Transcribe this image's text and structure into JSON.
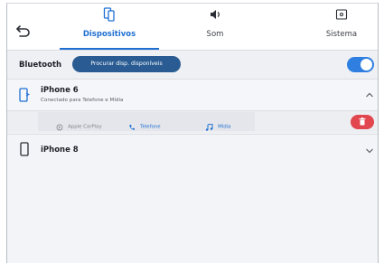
{
  "tabs": [
    {
      "label": "Dispositivos",
      "icon": "phone-link-icon",
      "active": true
    },
    {
      "label": "Som",
      "icon": "speaker-icon",
      "active": false
    },
    {
      "label": "Sistema",
      "icon": "system-screen-icon",
      "active": false
    }
  ],
  "bluetooth": {
    "label": "Bluetooth",
    "scan_button": "Procurar disp. disponíveis",
    "enabled": true
  },
  "devices": [
    {
      "name": "iPhone 6",
      "status": "Conectado para Telefone e Mídia",
      "expanded": true,
      "profiles": [
        {
          "label": "Apple CarPlay",
          "icon": "carplay-icon",
          "active": false
        },
        {
          "label": "Telefone",
          "icon": "phone-handset-icon",
          "active": true
        },
        {
          "label": "Mídia",
          "icon": "music-note-icon",
          "active": true
        }
      ]
    },
    {
      "name": "iPhone 8",
      "status": "",
      "expanded": false
    }
  ],
  "colors": {
    "accent": "#1f6fd2",
    "scan_button": "#2a5c93",
    "toggle_on": "#2f7fe0",
    "delete": "#e2474f"
  }
}
